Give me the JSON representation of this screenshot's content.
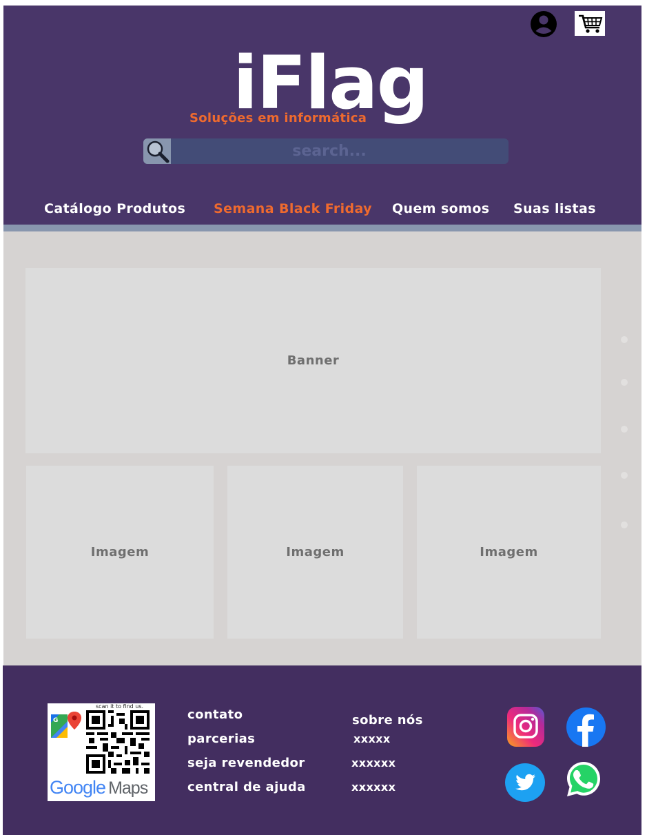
{
  "header": {
    "logo": "iFlag",
    "tagline": "Soluções em informática",
    "search": {
      "placeholder": "search..."
    },
    "icons": {
      "user": "user-circle-icon",
      "cart": "shopping-cart-icon"
    }
  },
  "nav": {
    "items": [
      {
        "label": "Catálogo Produtos"
      },
      {
        "label": "Semana Black Friday"
      },
      {
        "label": "Quem somos"
      },
      {
        "label": "Suas listas"
      }
    ]
  },
  "main": {
    "banner": "Banner",
    "images": [
      "Imagem",
      "Imagem",
      "Imagem"
    ],
    "carousel_dots": 5
  },
  "footer": {
    "qr": {
      "caption": "scan it to find us.",
      "brand_google": "Google",
      "brand_maps": "Maps"
    },
    "col1": [
      "contato",
      "parcerias",
      "seja revendedor",
      "central de ajuda"
    ],
    "col2": [
      "sobre nós",
      "xxxxx",
      "xxxxxx",
      "xxxxxx"
    ],
    "social": [
      "instagram-icon",
      "facebook-icon",
      "twitter-icon",
      "whatsapp-icon"
    ]
  },
  "colors": {
    "header_bg": "#493669",
    "footer_bg": "#432e60",
    "accent": "#ef6a2e",
    "content_bg": "#d6d3d2",
    "placeholder_bg": "#dcdcdc"
  }
}
